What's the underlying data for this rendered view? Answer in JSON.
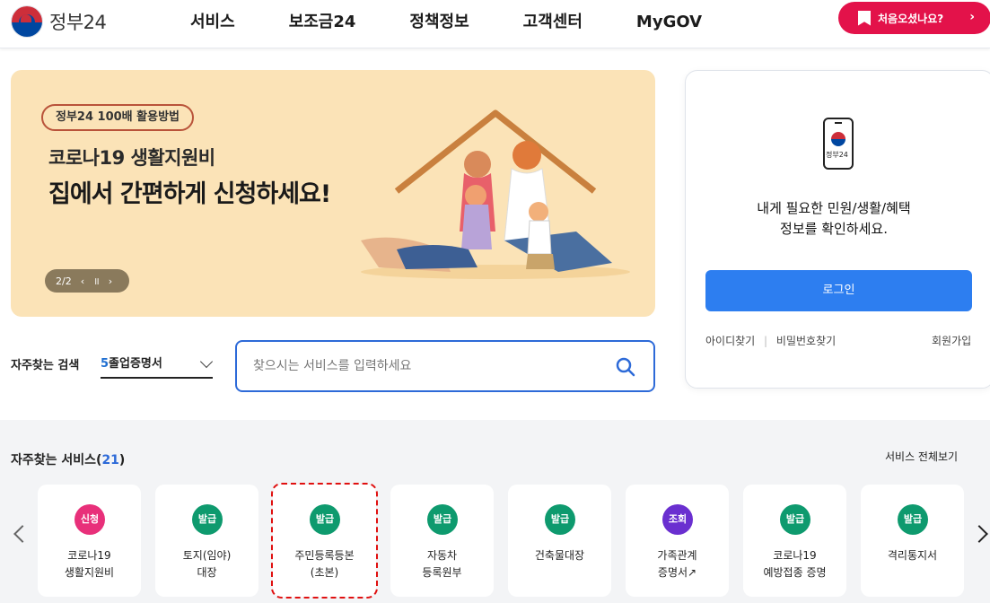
{
  "header": {
    "logo_text": "정부24",
    "nav": [
      "서비스",
      "보조금24",
      "정책정보",
      "고객센터",
      "MyGOV"
    ],
    "first_visit_label": "처음오셨나요?"
  },
  "banner": {
    "tag": "정부24 100배 활용방법",
    "line1": "코로나19 생활지원비",
    "line2": "집에서 간편하게 신청하세요!",
    "pager": "2/2",
    "prev": "‹",
    "pause": "॥",
    "next": "›"
  },
  "search": {
    "quick_label": "자주찾는 검색",
    "selected_num": "5",
    "selected_text": "졸업증명서",
    "placeholder": "찾으시는 서비스를 입력하세요"
  },
  "login": {
    "phone_text": "정부24",
    "message_line1": "내게 필요한 민원/생활/혜택",
    "message_line2": "정보를 확인하세요.",
    "button": "로그인",
    "find_id": "아이디찾기",
    "separator": "|",
    "find_pw": "비밀번호찾기",
    "signup": "회원가입"
  },
  "services": {
    "title": "자주찾는 서비스(",
    "count": "21",
    "title_end": ")",
    "view_all": "서비스 전체보기",
    "cards": [
      {
        "badge": "신청",
        "color": "#e8307a",
        "line1": "코로나19",
        "line2": "생활지원비"
      },
      {
        "badge": "발급",
        "color": "#0e9a6e",
        "line1": "토지(임야)",
        "line2": "대장"
      },
      {
        "badge": "발급",
        "color": "#0e9a6e",
        "line1": "주민등록등본",
        "line2": "(초본)"
      },
      {
        "badge": "발급",
        "color": "#0e9a6e",
        "line1": "자동차",
        "line2": "등록원부"
      },
      {
        "badge": "발급",
        "color": "#0e9a6e",
        "line1": "건축물대장",
        "line2": ""
      },
      {
        "badge": "조회",
        "color": "#6a2fd0",
        "line1": "가족관계",
        "line2": "증명서↗"
      },
      {
        "badge": "발급",
        "color": "#0e9a6e",
        "line1": "코로나19",
        "line2": "예방접종 증명"
      },
      {
        "badge": "발급",
        "color": "#0e9a6e",
        "line1": "격리통지서",
        "line2": ""
      }
    ]
  }
}
